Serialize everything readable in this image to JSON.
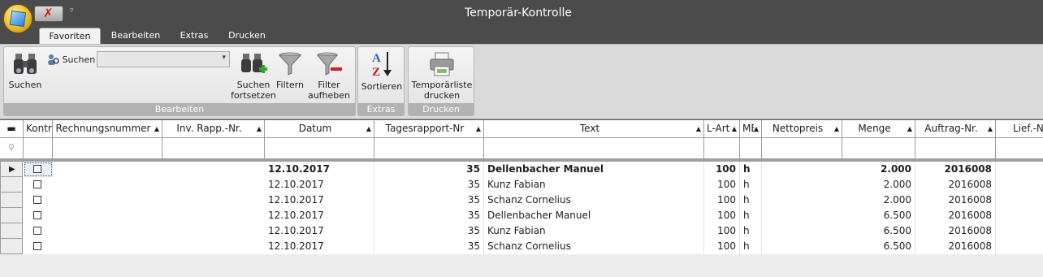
{
  "window": {
    "title": "Temporär-Kontrolle",
    "quick_access": "✗",
    "qat_dropdown": "▿"
  },
  "tabs": [
    "Favoriten",
    "Bearbeiten",
    "Extras",
    "Drucken"
  ],
  "ribbon": {
    "bearbeiten": {
      "label": "Bearbeiten",
      "search_big": "Suchen",
      "search_small": "Suchen",
      "search_combo_value": "",
      "continue_line1": "Suchen",
      "continue_line2": "fortsetzen",
      "filter": "Filtern",
      "filter_remove_line1": "Filter",
      "filter_remove_line2": "aufheben"
    },
    "extras": {
      "label": "Extras",
      "sort": "Sortieren"
    },
    "drucken": {
      "label": "Drucken",
      "print_line1": "Temporärliste",
      "print_line2": "drucken"
    }
  },
  "grid": {
    "columns": [
      "",
      "Kontrolliert",
      "Rechnungsnummer",
      "Inv. Rapp.-Nr.",
      "Datum",
      "Tagesrapport-Nr",
      "Text",
      "L-Art",
      "ME",
      "Nettopreis",
      "Menge",
      "Auftrag-Nr.",
      "Lief.-Nr."
    ],
    "sort_marker": "▲",
    "select_all": "▬",
    "filter_icon": "⚲",
    "current_row_marker": "▶",
    "rows": [
      {
        "datum": "12.10.2017",
        "rapport": "35",
        "text": "Dellenbacher Manuel",
        "lart": "100",
        "me": "h",
        "menge": "2.000",
        "auftrag": "2016008",
        "current": true
      },
      {
        "datum": "12.10.2017",
        "rapport": "35",
        "text": "Kunz Fabian",
        "lart": "100",
        "me": "h",
        "menge": "2.000",
        "auftrag": "2016008",
        "current": false
      },
      {
        "datum": "12.10.2017",
        "rapport": "35",
        "text": "Schanz Cornelius",
        "lart": "100",
        "me": "h",
        "menge": "2.000",
        "auftrag": "2016008",
        "current": false
      },
      {
        "datum": "12.10.2017",
        "rapport": "35",
        "text": "Dellenbacher Manuel",
        "lart": "100",
        "me": "h",
        "menge": "6.500",
        "auftrag": "2016008",
        "current": false
      },
      {
        "datum": "12.10.2017",
        "rapport": "35",
        "text": "Kunz Fabian",
        "lart": "100",
        "me": "h",
        "menge": "6.500",
        "auftrag": "2016008",
        "current": false
      },
      {
        "datum": "12.10.2017",
        "rapport": "35",
        "text": "Schanz Cornelius",
        "lart": "100",
        "me": "h",
        "menge": "6.500",
        "auftrag": "2016008",
        "current": false
      }
    ]
  }
}
